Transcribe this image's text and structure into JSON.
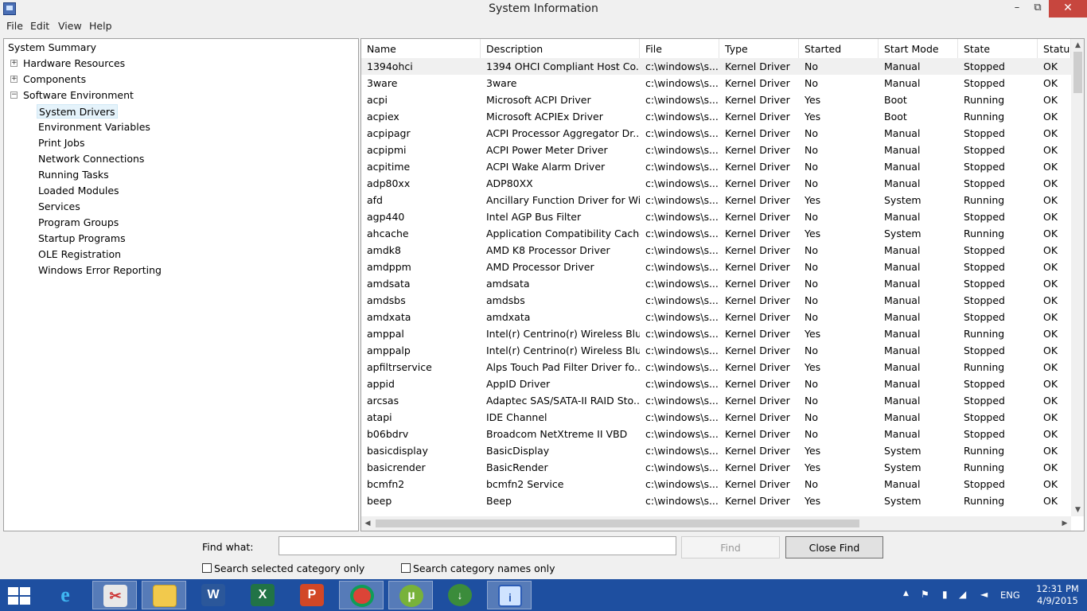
{
  "window": {
    "title": "System Information"
  },
  "menu": [
    "File",
    "Edit",
    "View",
    "Help"
  ],
  "tree": {
    "summary": "System Summary",
    "nodes": [
      {
        "label": "Hardware Resources",
        "expander": "+"
      },
      {
        "label": "Components",
        "expander": "+"
      },
      {
        "label": "Software Environment",
        "expander": "−"
      }
    ],
    "children": [
      "System Drivers",
      "Environment Variables",
      "Print Jobs",
      "Network Connections",
      "Running Tasks",
      "Loaded Modules",
      "Services",
      "Program Groups",
      "Startup Programs",
      "OLE Registration",
      "Windows Error Reporting"
    ],
    "selected": "System Drivers"
  },
  "table": {
    "columns": [
      "Name",
      "Description",
      "File",
      "Type",
      "Started",
      "Start Mode",
      "State",
      "Status"
    ],
    "rows": [
      [
        "1394ohci",
        "1394 OHCI Compliant Host Co...",
        "c:\\windows\\s...",
        "Kernel Driver",
        "No",
        "Manual",
        "Stopped",
        "OK"
      ],
      [
        "3ware",
        "3ware",
        "c:\\windows\\s...",
        "Kernel Driver",
        "No",
        "Manual",
        "Stopped",
        "OK"
      ],
      [
        "acpi",
        "Microsoft ACPI Driver",
        "c:\\windows\\s...",
        "Kernel Driver",
        "Yes",
        "Boot",
        "Running",
        "OK"
      ],
      [
        "acpiex",
        "Microsoft ACPIEx Driver",
        "c:\\windows\\s...",
        "Kernel Driver",
        "Yes",
        "Boot",
        "Running",
        "OK"
      ],
      [
        "acpipagr",
        "ACPI Processor Aggregator Dr...",
        "c:\\windows\\s...",
        "Kernel Driver",
        "No",
        "Manual",
        "Stopped",
        "OK"
      ],
      [
        "acpipmi",
        "ACPI Power Meter Driver",
        "c:\\windows\\s...",
        "Kernel Driver",
        "No",
        "Manual",
        "Stopped",
        "OK"
      ],
      [
        "acpitime",
        "ACPI Wake Alarm Driver",
        "c:\\windows\\s...",
        "Kernel Driver",
        "No",
        "Manual",
        "Stopped",
        "OK"
      ],
      [
        "adp80xx",
        "ADP80XX",
        "c:\\windows\\s...",
        "Kernel Driver",
        "No",
        "Manual",
        "Stopped",
        "OK"
      ],
      [
        "afd",
        "Ancillary Function Driver for Wi...",
        "c:\\windows\\s...",
        "Kernel Driver",
        "Yes",
        "System",
        "Running",
        "OK"
      ],
      [
        "agp440",
        "Intel AGP Bus Filter",
        "c:\\windows\\s...",
        "Kernel Driver",
        "No",
        "Manual",
        "Stopped",
        "OK"
      ],
      [
        "ahcache",
        "Application Compatibility Cache",
        "c:\\windows\\s...",
        "Kernel Driver",
        "Yes",
        "System",
        "Running",
        "OK"
      ],
      [
        "amdk8",
        "AMD K8 Processor Driver",
        "c:\\windows\\s...",
        "Kernel Driver",
        "No",
        "Manual",
        "Stopped",
        "OK"
      ],
      [
        "amdppm",
        "AMD Processor Driver",
        "c:\\windows\\s...",
        "Kernel Driver",
        "No",
        "Manual",
        "Stopped",
        "OK"
      ],
      [
        "amdsata",
        "amdsata",
        "c:\\windows\\s...",
        "Kernel Driver",
        "No",
        "Manual",
        "Stopped",
        "OK"
      ],
      [
        "amdsbs",
        "amdsbs",
        "c:\\windows\\s...",
        "Kernel Driver",
        "No",
        "Manual",
        "Stopped",
        "OK"
      ],
      [
        "amdxata",
        "amdxata",
        "c:\\windows\\s...",
        "Kernel Driver",
        "No",
        "Manual",
        "Stopped",
        "OK"
      ],
      [
        "amppal",
        "Intel(r) Centrino(r) Wireless Blu...",
        "c:\\windows\\s...",
        "Kernel Driver",
        "Yes",
        "Manual",
        "Running",
        "OK"
      ],
      [
        "amppalp",
        "Intel(r) Centrino(r) Wireless Blu...",
        "c:\\windows\\s...",
        "Kernel Driver",
        "No",
        "Manual",
        "Stopped",
        "OK"
      ],
      [
        "apfiltrservice",
        "Alps Touch Pad Filter Driver fo...",
        "c:\\windows\\s...",
        "Kernel Driver",
        "Yes",
        "Manual",
        "Running",
        "OK"
      ],
      [
        "appid",
        "AppID Driver",
        "c:\\windows\\s...",
        "Kernel Driver",
        "No",
        "Manual",
        "Stopped",
        "OK"
      ],
      [
        "arcsas",
        "Adaptec SAS/SATA-II RAID Sto...",
        "c:\\windows\\s...",
        "Kernel Driver",
        "No",
        "Manual",
        "Stopped",
        "OK"
      ],
      [
        "atapi",
        "IDE Channel",
        "c:\\windows\\s...",
        "Kernel Driver",
        "No",
        "Manual",
        "Stopped",
        "OK"
      ],
      [
        "b06bdrv",
        "Broadcom NetXtreme II VBD",
        "c:\\windows\\s...",
        "Kernel Driver",
        "No",
        "Manual",
        "Stopped",
        "OK"
      ],
      [
        "basicdisplay",
        "BasicDisplay",
        "c:\\windows\\s...",
        "Kernel Driver",
        "Yes",
        "System",
        "Running",
        "OK"
      ],
      [
        "basicrender",
        "BasicRender",
        "c:\\windows\\s...",
        "Kernel Driver",
        "Yes",
        "System",
        "Running",
        "OK"
      ],
      [
        "bcmfn2",
        "bcmfn2 Service",
        "c:\\windows\\s...",
        "Kernel Driver",
        "No",
        "Manual",
        "Stopped",
        "OK"
      ],
      [
        "beep",
        "Beep",
        "c:\\windows\\s...",
        "Kernel Driver",
        "Yes",
        "System",
        "Running",
        "OK"
      ]
    ]
  },
  "find": {
    "label": "Find what:",
    "value": "",
    "find_button": "Find",
    "close_button": "Close Find",
    "search_selected": "Search selected category only",
    "search_names": "Search category names only"
  },
  "taskbar": {
    "apps": [
      "internet-explorer",
      "snipping-tool",
      "file-explorer",
      "word",
      "excel",
      "powerpoint",
      "chrome",
      "utorrent",
      "internet-download-manager",
      "system-information"
    ],
    "language": "ENG",
    "time": "12:31 PM",
    "date": "4/9/2015"
  }
}
